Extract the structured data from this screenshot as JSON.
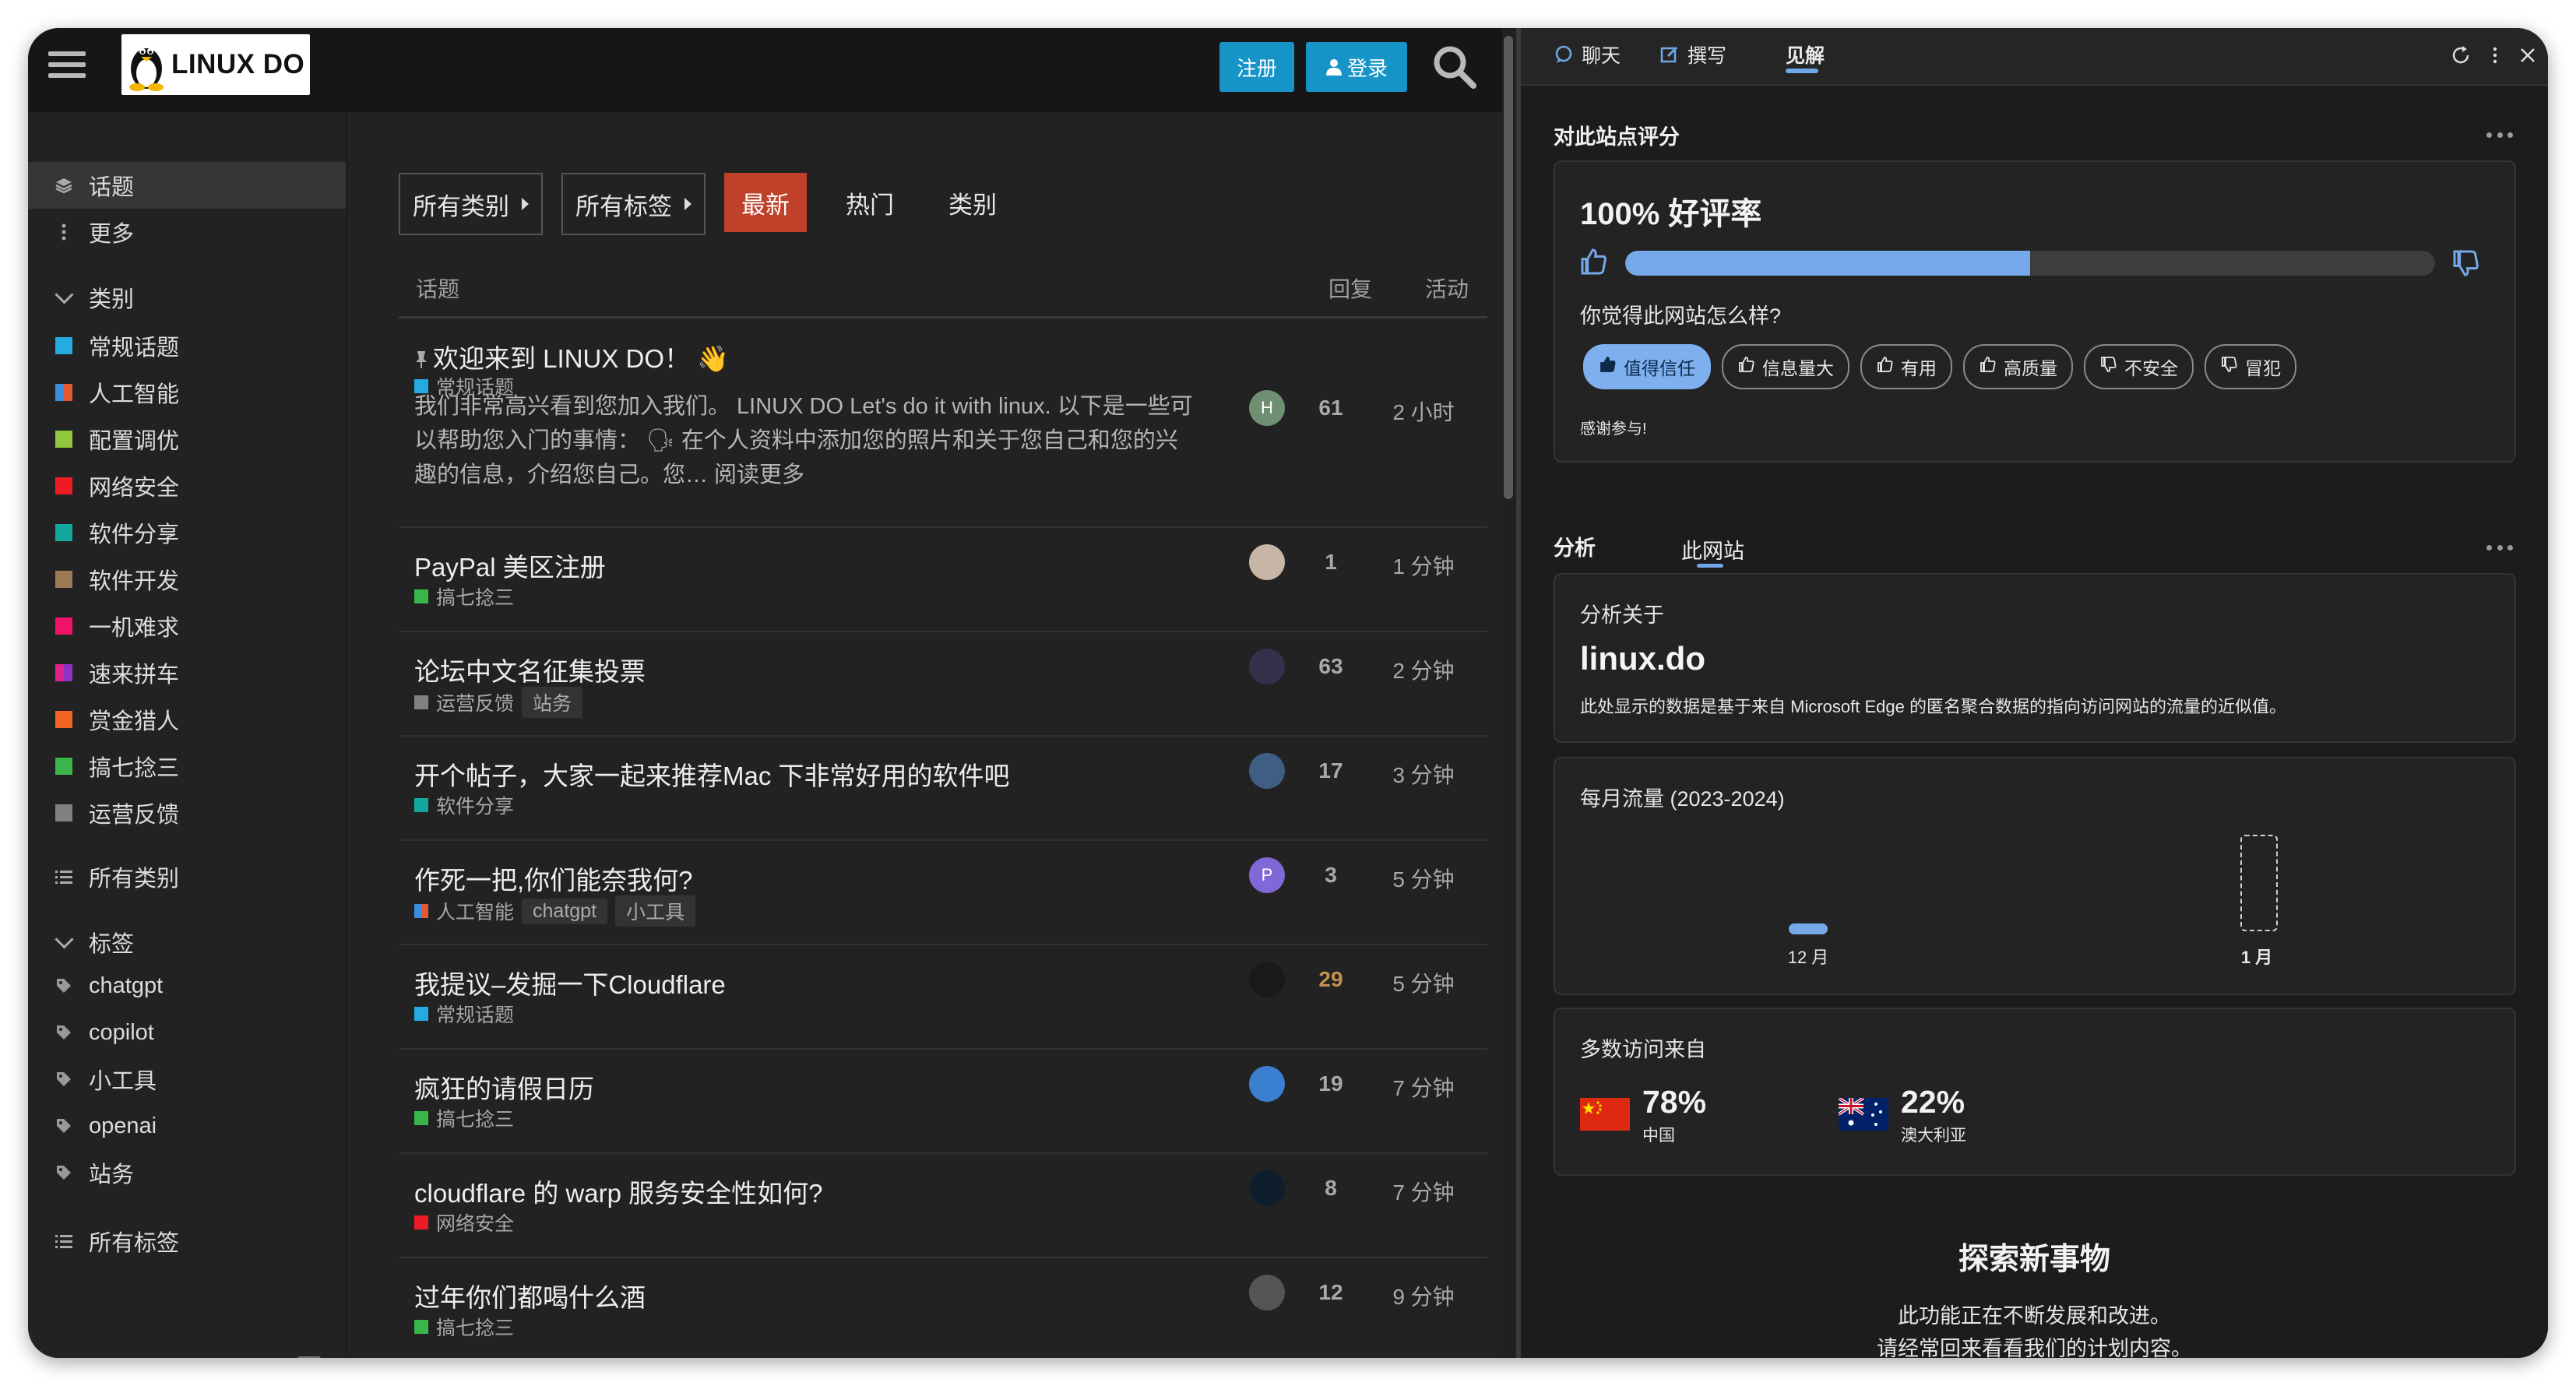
{
  "forum": {
    "logo_text": "LINUX DO",
    "signup": "注册",
    "login": "登录",
    "sidebar": {
      "top": [
        {
          "label": "话题"
        },
        {
          "label": "更多"
        }
      ],
      "categories_header": "类别",
      "categories": [
        {
          "label": "常规话题",
          "colors": [
            "#25aae1"
          ]
        },
        {
          "label": "人工智能",
          "colors": [
            "#3a8ee0",
            "#e45735"
          ]
        },
        {
          "label": "配置调优",
          "colors": [
            "#92c83e"
          ]
        },
        {
          "label": "网络安全",
          "colors": [
            "#ed1c24"
          ]
        },
        {
          "label": "软件分享",
          "colors": [
            "#12a89d"
          ]
        },
        {
          "label": "软件开发",
          "colors": [
            "#9e7a57"
          ]
        },
        {
          "label": "一机难求",
          "colors": [
            "#f0136b"
          ]
        },
        {
          "label": "速来拼车",
          "colors": [
            "#e0228e",
            "#8c33c7"
          ]
        },
        {
          "label": "赏金猎人",
          "colors": [
            "#f26522"
          ]
        },
        {
          "label": "搞七捻三",
          "colors": [
            "#3ab54a"
          ]
        },
        {
          "label": "运营反馈",
          "colors": [
            "#808281"
          ]
        }
      ],
      "all_categories": "所有类别",
      "tags_header": "标签",
      "tags": [
        "chatgpt",
        "copilot",
        "小工具",
        "openai",
        "站务"
      ],
      "all_tags": "所有标签"
    },
    "nav": {
      "all_categories": "所有类别",
      "all_tags": "所有标签",
      "latest": "最新",
      "hot": "热门",
      "categories": "类别"
    },
    "columns": {
      "topic": "话题",
      "replies": "回复",
      "activity": "活动"
    },
    "topics": [
      {
        "title": "欢迎来到 LINUX DO！ 👋",
        "pinned": true,
        "category": "常规话题",
        "cat_colors": [
          "#25aae1"
        ],
        "tags": [],
        "excerpt": "我们非常高兴看到您加入我们。 LINUX DO Let's do it with linux. 以下是一些可以帮助您入门的事情： 🗣 在个人资料中添加您的照片和关于您自己和您的兴趣的信息，介绍您自己。您… 阅读更多",
        "avatar_letter": "H",
        "avatar_color": "#6f8f72",
        "replies": "61",
        "activity": "2 小时"
      },
      {
        "title": "PayPal 美区注册",
        "category": "搞七捻三",
        "cat_colors": [
          "#3ab54a"
        ],
        "tags": [],
        "avatar_letter": "",
        "avatar_color": "#c7b6a5",
        "replies": "1",
        "activity": "1 分钟"
      },
      {
        "title": "论坛中文名征集投票",
        "category": "运营反馈",
        "cat_colors": [
          "#808281"
        ],
        "tags": [
          "站务"
        ],
        "avatar_letter": "",
        "avatar_color": "#35304a",
        "replies": "63",
        "activity": "2 分钟"
      },
      {
        "title": "开个帖子，大家一起来推荐Mac 下非常好用的软件吧",
        "category": "软件分享",
        "cat_colors": [
          "#12a89d"
        ],
        "tags": [],
        "avatar_letter": "",
        "avatar_color": "#3f5e83",
        "replies": "17",
        "activity": "3 分钟"
      },
      {
        "title": "作死一把,你们能奈我何?",
        "category": "人工智能",
        "cat_colors": [
          "#3a8ee0",
          "#e45735"
        ],
        "tags": [
          "chatgpt",
          "小工具"
        ],
        "avatar_letter": "P",
        "avatar_color": "#8068d8",
        "replies": "3",
        "activity": "5 分钟"
      },
      {
        "title": "我提议–发掘一下Cloudflare",
        "category": "常规话题",
        "cat_colors": [
          "#25aae1"
        ],
        "tags": [],
        "avatar_letter": "",
        "avatar_color": "#1a1a1a",
        "replies": "29",
        "hot": true,
        "activity": "5 分钟"
      },
      {
        "title": "疯狂的请假日历",
        "category": "搞七捻三",
        "cat_colors": [
          "#3ab54a"
        ],
        "tags": [],
        "avatar_letter": "",
        "avatar_color": "#3b7fd1",
        "replies": "19",
        "activity": "7 分钟"
      },
      {
        "title": "cloudflare 的 warp 服务安全性如何?",
        "category": "网络安全",
        "cat_colors": [
          "#ed1c24"
        ],
        "tags": [],
        "avatar_letter": "",
        "avatar_color": "#0f1e2c",
        "replies": "8",
        "activity": "7 分钟"
      },
      {
        "title": "过年你们都喝什么酒",
        "category": "搞七捻三",
        "cat_colors": [
          "#3ab54a"
        ],
        "tags": [],
        "avatar_letter": "",
        "avatar_color": "#555",
        "replies": "12",
        "activity": "9 分钟"
      }
    ]
  },
  "edge": {
    "tabs": [
      {
        "label": "聊天",
        "icon": "chat-icon"
      },
      {
        "label": "撰写",
        "icon": "compose-icon"
      },
      {
        "label": "见解",
        "icon": "",
        "active": true
      }
    ],
    "rating": {
      "section_title": "对此站点评分",
      "headline": "100% 好评率",
      "positive_fraction": 0.5,
      "question": "你觉得此网站怎么样?",
      "chips": [
        {
          "label": "值得信任",
          "selected": true,
          "icon": "thumb-up-filled-icon"
        },
        {
          "label": "信息量大",
          "icon": "thumb-up-icon"
        },
        {
          "label": "有用",
          "icon": "thumb-up-icon"
        },
        {
          "label": "高质量",
          "icon": "thumb-up-icon"
        },
        {
          "label": "不安全",
          "icon": "thumb-down-icon"
        },
        {
          "label": "冒犯",
          "icon": "thumb-down-icon"
        }
      ],
      "thanks": "感谢参与!"
    },
    "analysis": {
      "tab_analysis": "分析",
      "tab_site": "此网站",
      "label": "分析关于",
      "site": "linux.do",
      "description": "此处显示的数据是基于来自 Microsoft Edge 的匿名聚合数据的指向访问网站的流量的近似值。"
    },
    "traffic": {
      "title": "每月流量 (2023-2024)",
      "months": [
        "12 月",
        "1 月"
      ]
    },
    "visitors": {
      "title": "多数访问来自",
      "countries": [
        {
          "pct": "78%",
          "name": "中国"
        },
        {
          "pct": "22%",
          "name": "澳大利亚"
        }
      ]
    },
    "explore": {
      "title": "探索新事物",
      "line1": "此功能正在不断发展和改进。",
      "line2": "请经常回来看看我们的计划内容。"
    }
  }
}
